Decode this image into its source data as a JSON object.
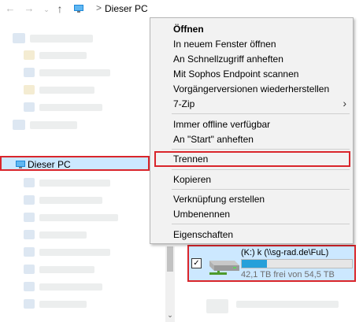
{
  "address_bar": {
    "back_icon": "arrow-left-icon",
    "forward_icon": "arrow-right-icon",
    "up_icon": "arrow-up-icon",
    "location_icon": "this-pc-icon",
    "separator": ">",
    "location": "Dieser PC"
  },
  "nav_pane": {
    "selected_item": {
      "icon": "this-pc-icon",
      "label": "Dieser PC"
    }
  },
  "drive": {
    "checked": true,
    "name": "(K:) k (\\\\sg-rad.de\\FuL)",
    "free_text": "42,1 TB frei von 54,5 TB",
    "used_fraction": 0.23,
    "bar_color": "#26a0da"
  },
  "context_menu": {
    "items": [
      {
        "label": "Öffnen",
        "bold": true
      },
      {
        "label": "In neuem Fenster öffnen"
      },
      {
        "label": "An Schnellzugriff anheften"
      },
      {
        "label": "Mit Sophos Endpoint scannen"
      },
      {
        "label": "Vorgängerversionen wiederherstellen"
      },
      {
        "label": "7-Zip",
        "submenu": true,
        "submenu_glyph": "›"
      },
      {
        "label": "Immer offline verfügbar"
      },
      {
        "label": "An \"Start\" anheften"
      },
      {
        "label": "Trennen",
        "highlighted": true
      },
      {
        "label": "Kopieren"
      },
      {
        "label": "Verknüpfung erstellen"
      },
      {
        "label": "Umbenennen"
      },
      {
        "label": "Eigenschaften"
      }
    ]
  },
  "colors": {
    "highlight_border": "#d9252b",
    "selection_bg": "#cce8ff",
    "menu_bg": "#f2f2f2"
  }
}
